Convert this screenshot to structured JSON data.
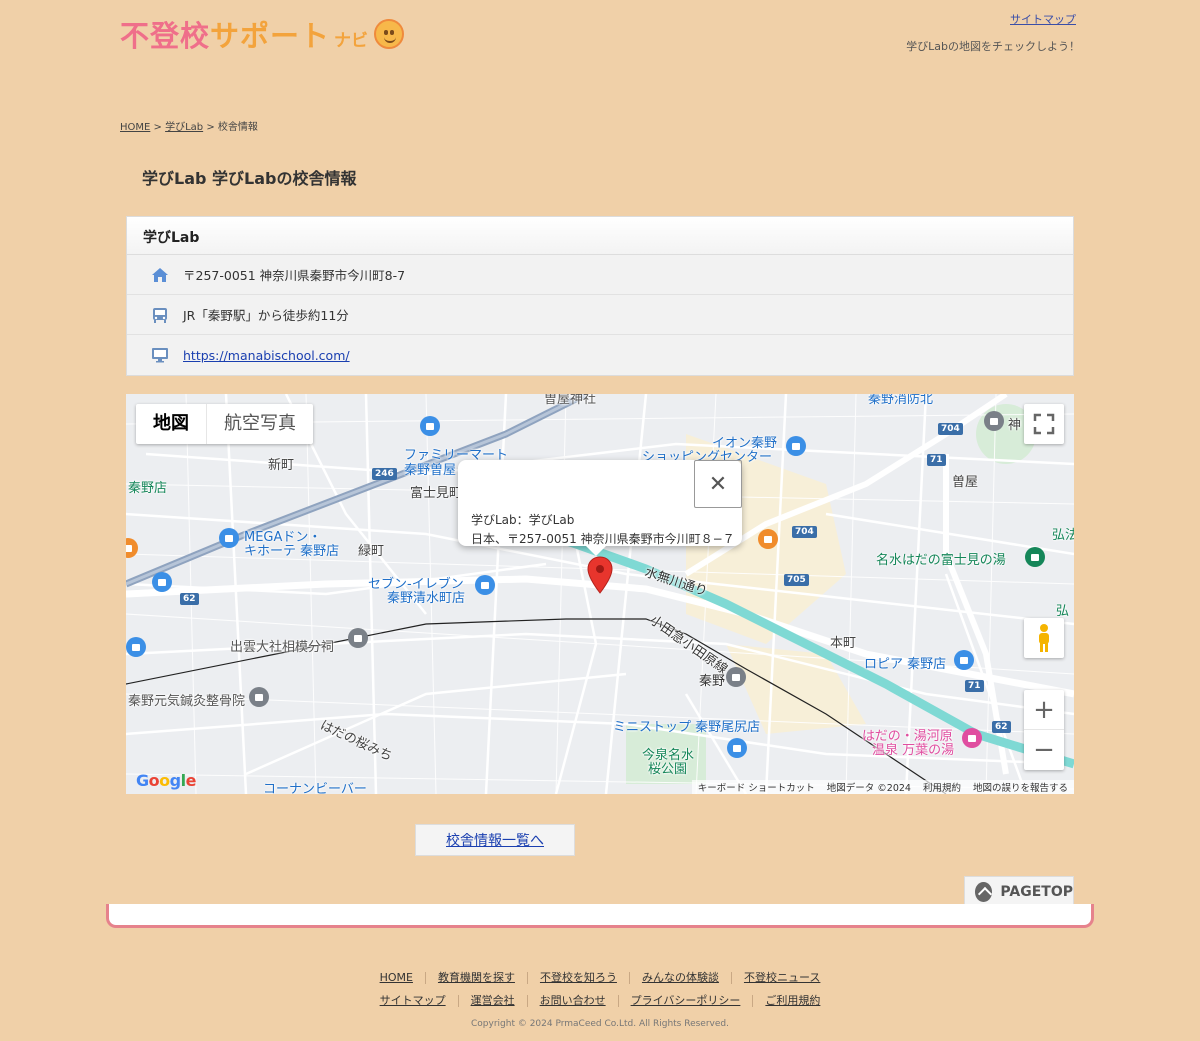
{
  "header": {
    "logo_part1": "不登校",
    "logo_part2": "サポート",
    "logo_navi": "ナビ",
    "sitemap": "サイトマップ",
    "tagline": "学びLabの地図をチェックしよう！"
  },
  "breadcrumb": {
    "home": "HOME",
    "sep1": " > ",
    "school": "学びLab",
    "sep2": " > ",
    "current": "校舎情報"
  },
  "page_title": "学びLab 学びLabの校舎情報",
  "card": {
    "name": "学びLab",
    "address": "〒257-0051 神奈川県秦野市今川町8-7",
    "access": "JR「秦野駅」から徒歩約11分",
    "url": "https://manabischool.com/"
  },
  "map": {
    "type_map": "地図",
    "type_satellite": "航空写真",
    "info_line1": "学びLab：学びLab",
    "info_line2": "日本、〒257-0051 神奈川県秦野市今川町８−７",
    "close": "✕",
    "google": "Google",
    "footer": {
      "shortcuts": "キーボード ショートカット",
      "data": "地図データ ©2024",
      "terms": "利用規約",
      "report": "地図の誤りを報告する"
    },
    "labels": {
      "family_mart": "ファミリーマート",
      "family_mart2": "秦野曽屋",
      "aeon": "イオン秦野",
      "aeon2": "ショッピングセンター",
      "shinmachi": "新町",
      "hadano_store": "秦野店",
      "fujimi": "富士見町",
      "mega": "MEGAドン・",
      "mega2": "キホーテ 秦野店",
      "midori": "緑町",
      "seven": "セブン-イレブン",
      "seven2": "秦野清水町店",
      "mizunashi": "水無川通り",
      "odakyu": "小田急小田原線",
      "izumo": "出雲大社相模分祠",
      "hadano": "秦野",
      "honcho": "本町",
      "ropia": "ロピア 秦野店",
      "nadaka": "名水はだの富士見の湯",
      "soya": "曽屋",
      "ministop": "ミニストップ 秦野尾尻店",
      "imaizumi": "今泉名水",
      "imaizumi2": "桜公園",
      "sakura": "はだの桜みち",
      "konan": "コーナンビーバー",
      "moto": "秦野元気鍼灸整骨院",
      "yumori": "はだの・湯河原",
      "yumori2": "温泉 万葉の湯",
      "sodaya": "曽屋神社",
      "kami": "神",
      "hiroshi": "弘法",
      "hiroshi2": "弘",
      "hadano_kita": "秦野消防北"
    },
    "route_numbers": [
      "246",
      "62",
      "704",
      "71",
      "705",
      "71",
      "62",
      "704"
    ],
    "colors": {
      "river": "#7fd9d4",
      "road": "#ffffff",
      "highway": "#8fa3bf",
      "marker": "#e8352d",
      "poi_blue": "#3b8fe6",
      "poi_orange": "#f08c2c",
      "poi_pink": "#e04ea0",
      "poi_gray": "#7a8088",
      "label_blue": "#1f6fc8",
      "label_green": "#158659"
    }
  },
  "list_button": "校舎情報一覧へ",
  "pagetop": "PAGETOP",
  "footer": {
    "nav1": [
      "HOME",
      "教育機関を探す",
      "不登校を知ろう",
      "みんなの体験談",
      "不登校ニュース"
    ],
    "nav2": [
      "サイトマップ",
      "運営会社",
      "お問い合わせ",
      "プライバシーポリシー",
      "ご利用規約"
    ],
    "copyright": "Copyright © 2024 PrmaCeed Co.Ltd. All Rights Reserved."
  }
}
